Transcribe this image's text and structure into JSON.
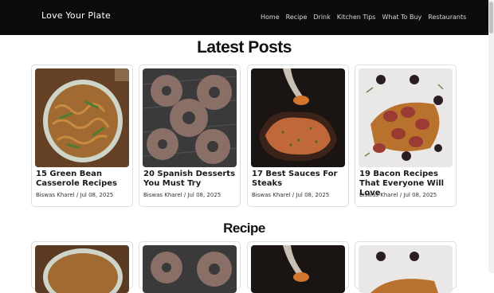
{
  "site": {
    "brand": "Love Your Plate"
  },
  "nav": [
    "Home",
    "Recipe",
    "Drink",
    "Kitchen Tips",
    "What To Buy",
    "Restaurants"
  ],
  "sections": {
    "latest": "Latest Posts",
    "recipe": "Recipe"
  },
  "posts": [
    {
      "title": "15 Green Bean Casserole Recipes",
      "author": "Biswas Kharel",
      "sep": "/",
      "date": "Jul 08, 2025",
      "image": "green-bean-casserole-image"
    },
    {
      "title": "20 Spanish Desserts You Must Try",
      "author": "Biswas Kharel",
      "sep": "/",
      "date": "Jul 08, 2025",
      "image": "spanish-donuts-image"
    },
    {
      "title": "17 Best Sauces For Steaks",
      "author": "Biswas Kharel",
      "sep": "/",
      "date": "Jul 08, 2025",
      "image": "steak-sauce-image"
    },
    {
      "title": "19 Bacon Recipes That Everyone Will Love",
      "author": "Biswas Kharel",
      "sep": "/",
      "date": "Jul 08, 2025",
      "image": "bacon-wrapped-dates-image"
    }
  ],
  "colors": {
    "navbar": "#0c0c0f",
    "title": "#111111",
    "card_border": "#dedede"
  }
}
